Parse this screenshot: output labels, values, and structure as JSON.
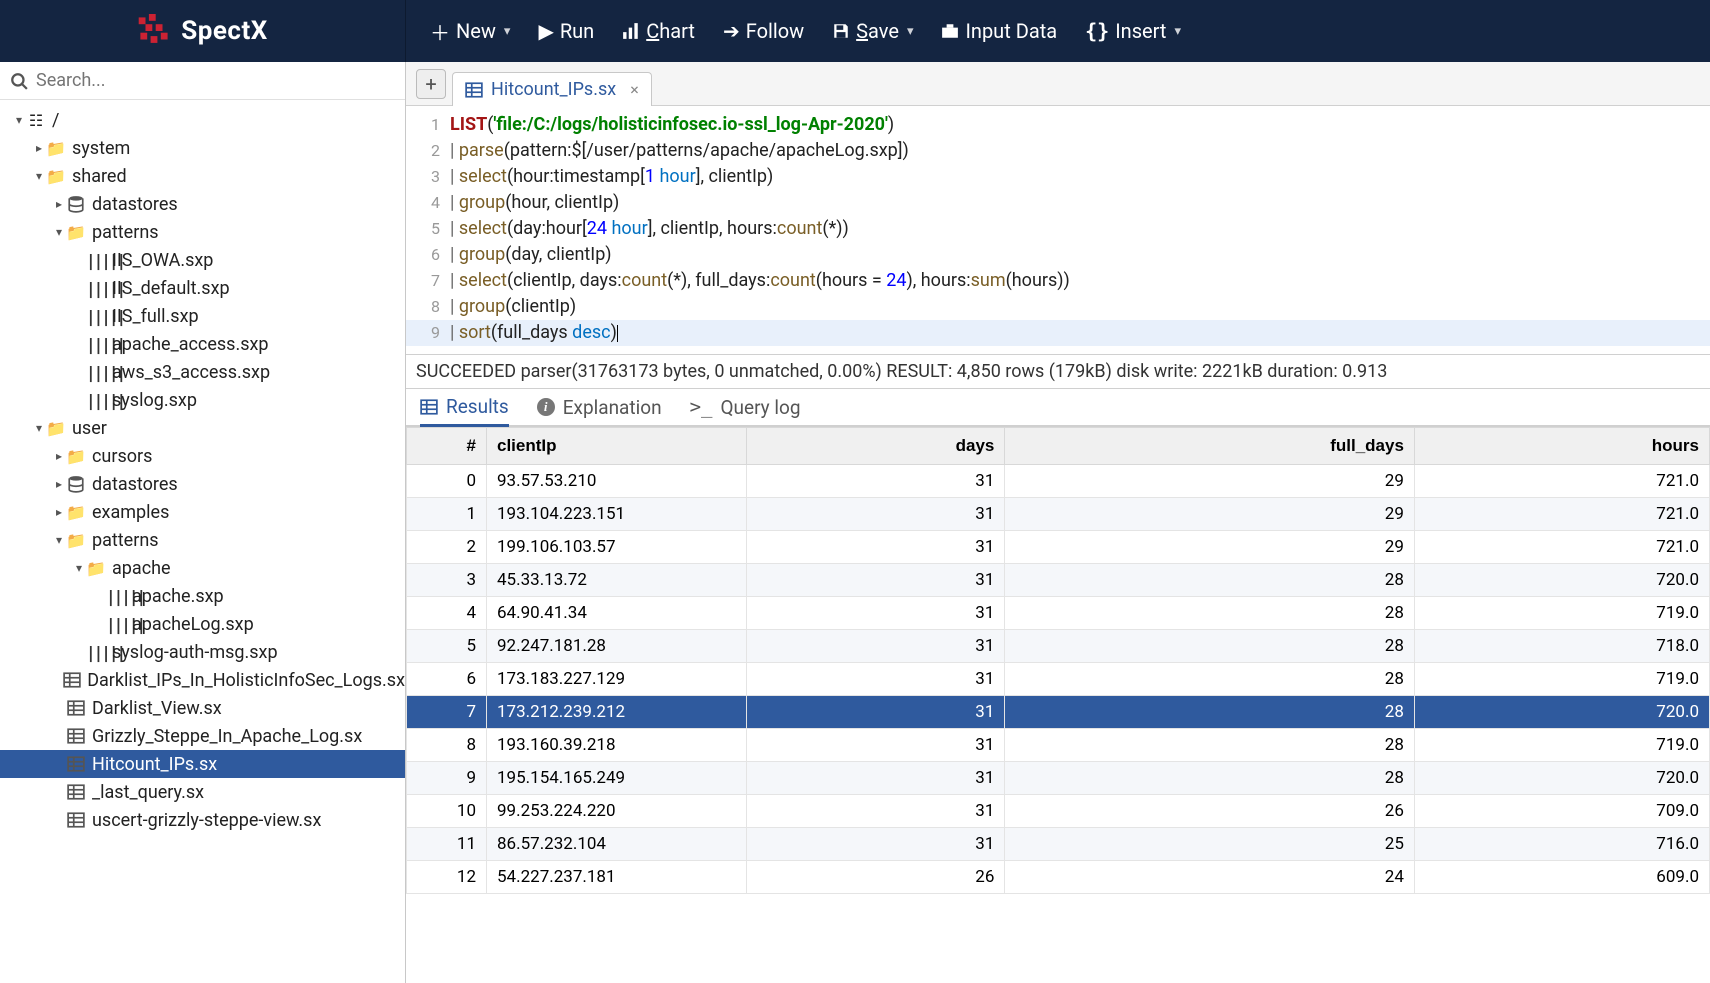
{
  "brand": "SpectX",
  "toolbar": {
    "new": "New",
    "run": "Run",
    "chart": "Chart",
    "follow": "Follow",
    "save": "Save",
    "input": "Input Data",
    "insert": "Insert"
  },
  "search_placeholder": "Search...",
  "tree_root_label": "/",
  "tree": [
    {
      "d": 1,
      "exp": "closed",
      "icon": "folder",
      "label": "system"
    },
    {
      "d": 1,
      "exp": "open",
      "icon": "folder",
      "label": "shared"
    },
    {
      "d": 2,
      "exp": "closed",
      "icon": "db",
      "label": "datastores"
    },
    {
      "d": 2,
      "exp": "open",
      "icon": "folder",
      "label": "patterns"
    },
    {
      "d": 3,
      "exp": "none",
      "icon": "bar",
      "label": "IIS_OWA.sxp"
    },
    {
      "d": 3,
      "exp": "none",
      "icon": "bar",
      "label": "IIS_default.sxp"
    },
    {
      "d": 3,
      "exp": "none",
      "icon": "bar",
      "label": "IIS_full.sxp"
    },
    {
      "d": 3,
      "exp": "none",
      "icon": "bar",
      "label": "apache_access.sxp"
    },
    {
      "d": 3,
      "exp": "none",
      "icon": "bar",
      "label": "aws_s3_access.sxp"
    },
    {
      "d": 3,
      "exp": "none",
      "icon": "bar",
      "label": "syslog.sxp"
    },
    {
      "d": 1,
      "exp": "open",
      "icon": "folder",
      "label": "user"
    },
    {
      "d": 2,
      "exp": "closed",
      "icon": "folder",
      "label": "cursors"
    },
    {
      "d": 2,
      "exp": "closed",
      "icon": "db",
      "label": "datastores"
    },
    {
      "d": 2,
      "exp": "closed",
      "icon": "folder",
      "label": "examples"
    },
    {
      "d": 2,
      "exp": "open",
      "icon": "folder",
      "label": "patterns"
    },
    {
      "d": 3,
      "exp": "open",
      "icon": "folder",
      "label": "apache"
    },
    {
      "d": 4,
      "exp": "none",
      "icon": "bar",
      "label": "apache.sxp"
    },
    {
      "d": 4,
      "exp": "none",
      "icon": "bar",
      "label": "apacheLog.sxp"
    },
    {
      "d": 3,
      "exp": "none",
      "icon": "bar",
      "label": "syslog-auth-msg.sxp"
    },
    {
      "d": 2,
      "exp": "none",
      "icon": "table",
      "label": "Darklist_IPs_In_HolisticInfoSec_Logs.sx"
    },
    {
      "d": 2,
      "exp": "none",
      "icon": "table",
      "label": "Darklist_View.sx"
    },
    {
      "d": 2,
      "exp": "none",
      "icon": "table",
      "label": "Grizzly_Steppe_In_Apache_Log.sx"
    },
    {
      "d": 2,
      "exp": "none",
      "icon": "table",
      "label": "Hitcount_IPs.sx",
      "sel": true
    },
    {
      "d": 2,
      "exp": "none",
      "icon": "table",
      "label": "_last_query.sx"
    },
    {
      "d": 2,
      "exp": "none",
      "icon": "table",
      "label": "uscert-grizzly-steppe-view.sx"
    }
  ],
  "tab_label": "Hitcount_IPs.sx",
  "code": {
    "l1": {
      "kw": "LIST",
      "str": "'file:/C:/logs/holisticinfosec.io-ssl_log-Apr-2020'"
    },
    "l2": "| parse(pattern:$[/user/patterns/apache/apacheLog.sxp])",
    "l3": "| select(hour:timestamp[1 hour], clientIp)",
    "l4": "| group(hour, clientIp)",
    "l5": "| select(day:hour[24 hour], clientIp, hours:count(*))",
    "l6": "| group(day, clientIp)",
    "l7": "| select(clientIp, days:count(*), full_days:count(hours = 24), hours:sum(hours))",
    "l8": "| group(clientIp)",
    "l9": "| sort(full_days desc)"
  },
  "status": "SUCCEEDED parser(31763173 bytes, 0 unmatched, 0.00%) RESULT: 4,850 rows (179kB) disk write: 2221kB duration: 0.913",
  "rtabs": {
    "results": "Results",
    "explanation": "Explanation",
    "querylog": "Query log"
  },
  "grid": {
    "cols": [
      "#",
      "clientIp",
      "days",
      "full_days",
      "hours"
    ],
    "rows": [
      {
        "i": 0,
        "ip": "93.57.53.210",
        "days": 31,
        "fd": 29,
        "h": "721.0"
      },
      {
        "i": 1,
        "ip": "193.104.223.151",
        "days": 31,
        "fd": 29,
        "h": "721.0"
      },
      {
        "i": 2,
        "ip": "199.106.103.57",
        "days": 31,
        "fd": 29,
        "h": "721.0"
      },
      {
        "i": 3,
        "ip": "45.33.13.72",
        "days": 31,
        "fd": 28,
        "h": "720.0"
      },
      {
        "i": 4,
        "ip": "64.90.41.34",
        "days": 31,
        "fd": 28,
        "h": "719.0"
      },
      {
        "i": 5,
        "ip": "92.247.181.28",
        "days": 31,
        "fd": 28,
        "h": "718.0"
      },
      {
        "i": 6,
        "ip": "173.183.227.129",
        "days": 31,
        "fd": 28,
        "h": "719.0"
      },
      {
        "i": 7,
        "ip": "173.212.239.212",
        "days": 31,
        "fd": 28,
        "h": "720.0",
        "sel": true
      },
      {
        "i": 8,
        "ip": "193.160.39.218",
        "days": 31,
        "fd": 28,
        "h": "719.0"
      },
      {
        "i": 9,
        "ip": "195.154.165.249",
        "days": 31,
        "fd": 28,
        "h": "720.0"
      },
      {
        "i": 10,
        "ip": "99.253.224.220",
        "days": 31,
        "fd": 26,
        "h": "709.0"
      },
      {
        "i": 11,
        "ip": "86.57.232.104",
        "days": 31,
        "fd": 25,
        "h": "716.0"
      },
      {
        "i": 12,
        "ip": "54.227.237.181",
        "days": 26,
        "fd": 24,
        "h": "609.0"
      }
    ]
  }
}
